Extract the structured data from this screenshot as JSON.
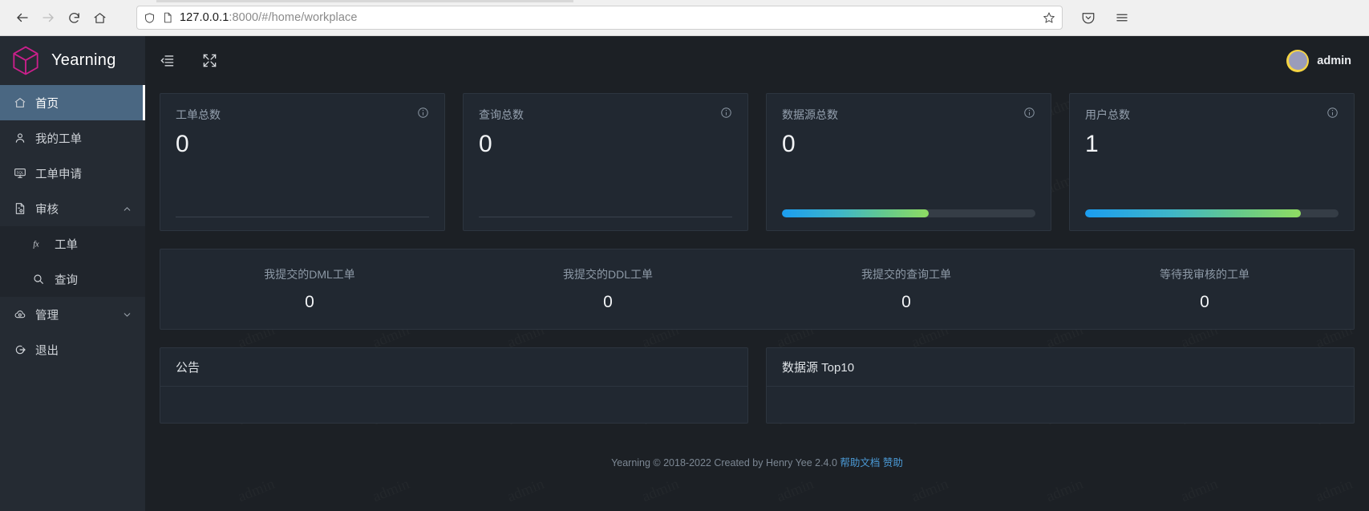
{
  "browser": {
    "back_icon": "back-arrow-icon",
    "forward_icon": "forward-arrow-icon",
    "reload_icon": "reload-icon",
    "home_icon": "home-icon",
    "shield_icon": "shield-icon",
    "page_icon": "page-icon",
    "bookmark_icon": "star-icon",
    "pocket_icon": "pocket-icon",
    "menu_icon": "hamburger-menu-icon",
    "url_host": "127.0.0.1",
    "url_rest": ":8000/#/home/workplace",
    "url_full": "127.0.0.1:8000/#/home/workplace"
  },
  "sidebar": {
    "brand": "Yearning",
    "items": [
      {
        "label": "首页",
        "icon": "home-icon",
        "active": true
      },
      {
        "label": "我的工单",
        "icon": "user-icon",
        "active": false
      },
      {
        "label": "工单申请",
        "icon": "monitor-sql-icon",
        "active": false
      },
      {
        "label": "审核",
        "icon": "audit-icon",
        "active": false,
        "expanded": true
      }
    ],
    "submenu": [
      {
        "label": "工单",
        "icon": "function-fx-icon"
      },
      {
        "label": "查询",
        "icon": "search-icon"
      }
    ],
    "items_after": [
      {
        "label": "管理",
        "icon": "cloud-gear-icon",
        "expanded": false
      },
      {
        "label": "退出",
        "icon": "logout-icon"
      }
    ]
  },
  "topbar": {
    "collapse_icon": "menu-fold-icon",
    "fullscreen_icon": "fullscreen-icon",
    "user_name": "admin",
    "avatar": "user-avatar"
  },
  "watermark_text": "admin",
  "stats": [
    {
      "title": "工单总数",
      "value": "0",
      "info_icon": "info-circle-icon",
      "has_progress": false,
      "progress_pct": 0
    },
    {
      "title": "查询总数",
      "value": "0",
      "info_icon": "info-circle-icon",
      "has_progress": false,
      "progress_pct": 0
    },
    {
      "title": "数据源总数",
      "value": "0",
      "info_icon": "info-circle-icon",
      "has_progress": true,
      "progress_pct": 58
    },
    {
      "title": "用户总数",
      "value": "1",
      "info_icon": "info-circle-icon",
      "has_progress": true,
      "progress_pct": 85
    }
  ],
  "counters": [
    {
      "label": "我提交的DML工单",
      "value": "0"
    },
    {
      "label": "我提交的DDL工单",
      "value": "0"
    },
    {
      "label": "我提交的查询工单",
      "value": "0"
    },
    {
      "label": "等待我审核的工单",
      "value": "0"
    }
  ],
  "panels": [
    {
      "title": "公告"
    },
    {
      "title": "数据源 Top10"
    }
  ],
  "footer": {
    "text": "Yearning © 2018-2022 Created by Henry Yee    2.4.0",
    "link1": "帮助文档",
    "link2": "赞助"
  },
  "colors": {
    "brand_magenta": "#cc1f8c",
    "sidebar_bg": "#252b33",
    "content_bg": "#1c2025",
    "card_bg": "#212831",
    "active_nav": "#4a6782",
    "progress_start": "#1b9df0",
    "progress_end": "#8fdc62",
    "avatar_yellow": "#f5d443",
    "link_blue": "#4b9ad6"
  }
}
